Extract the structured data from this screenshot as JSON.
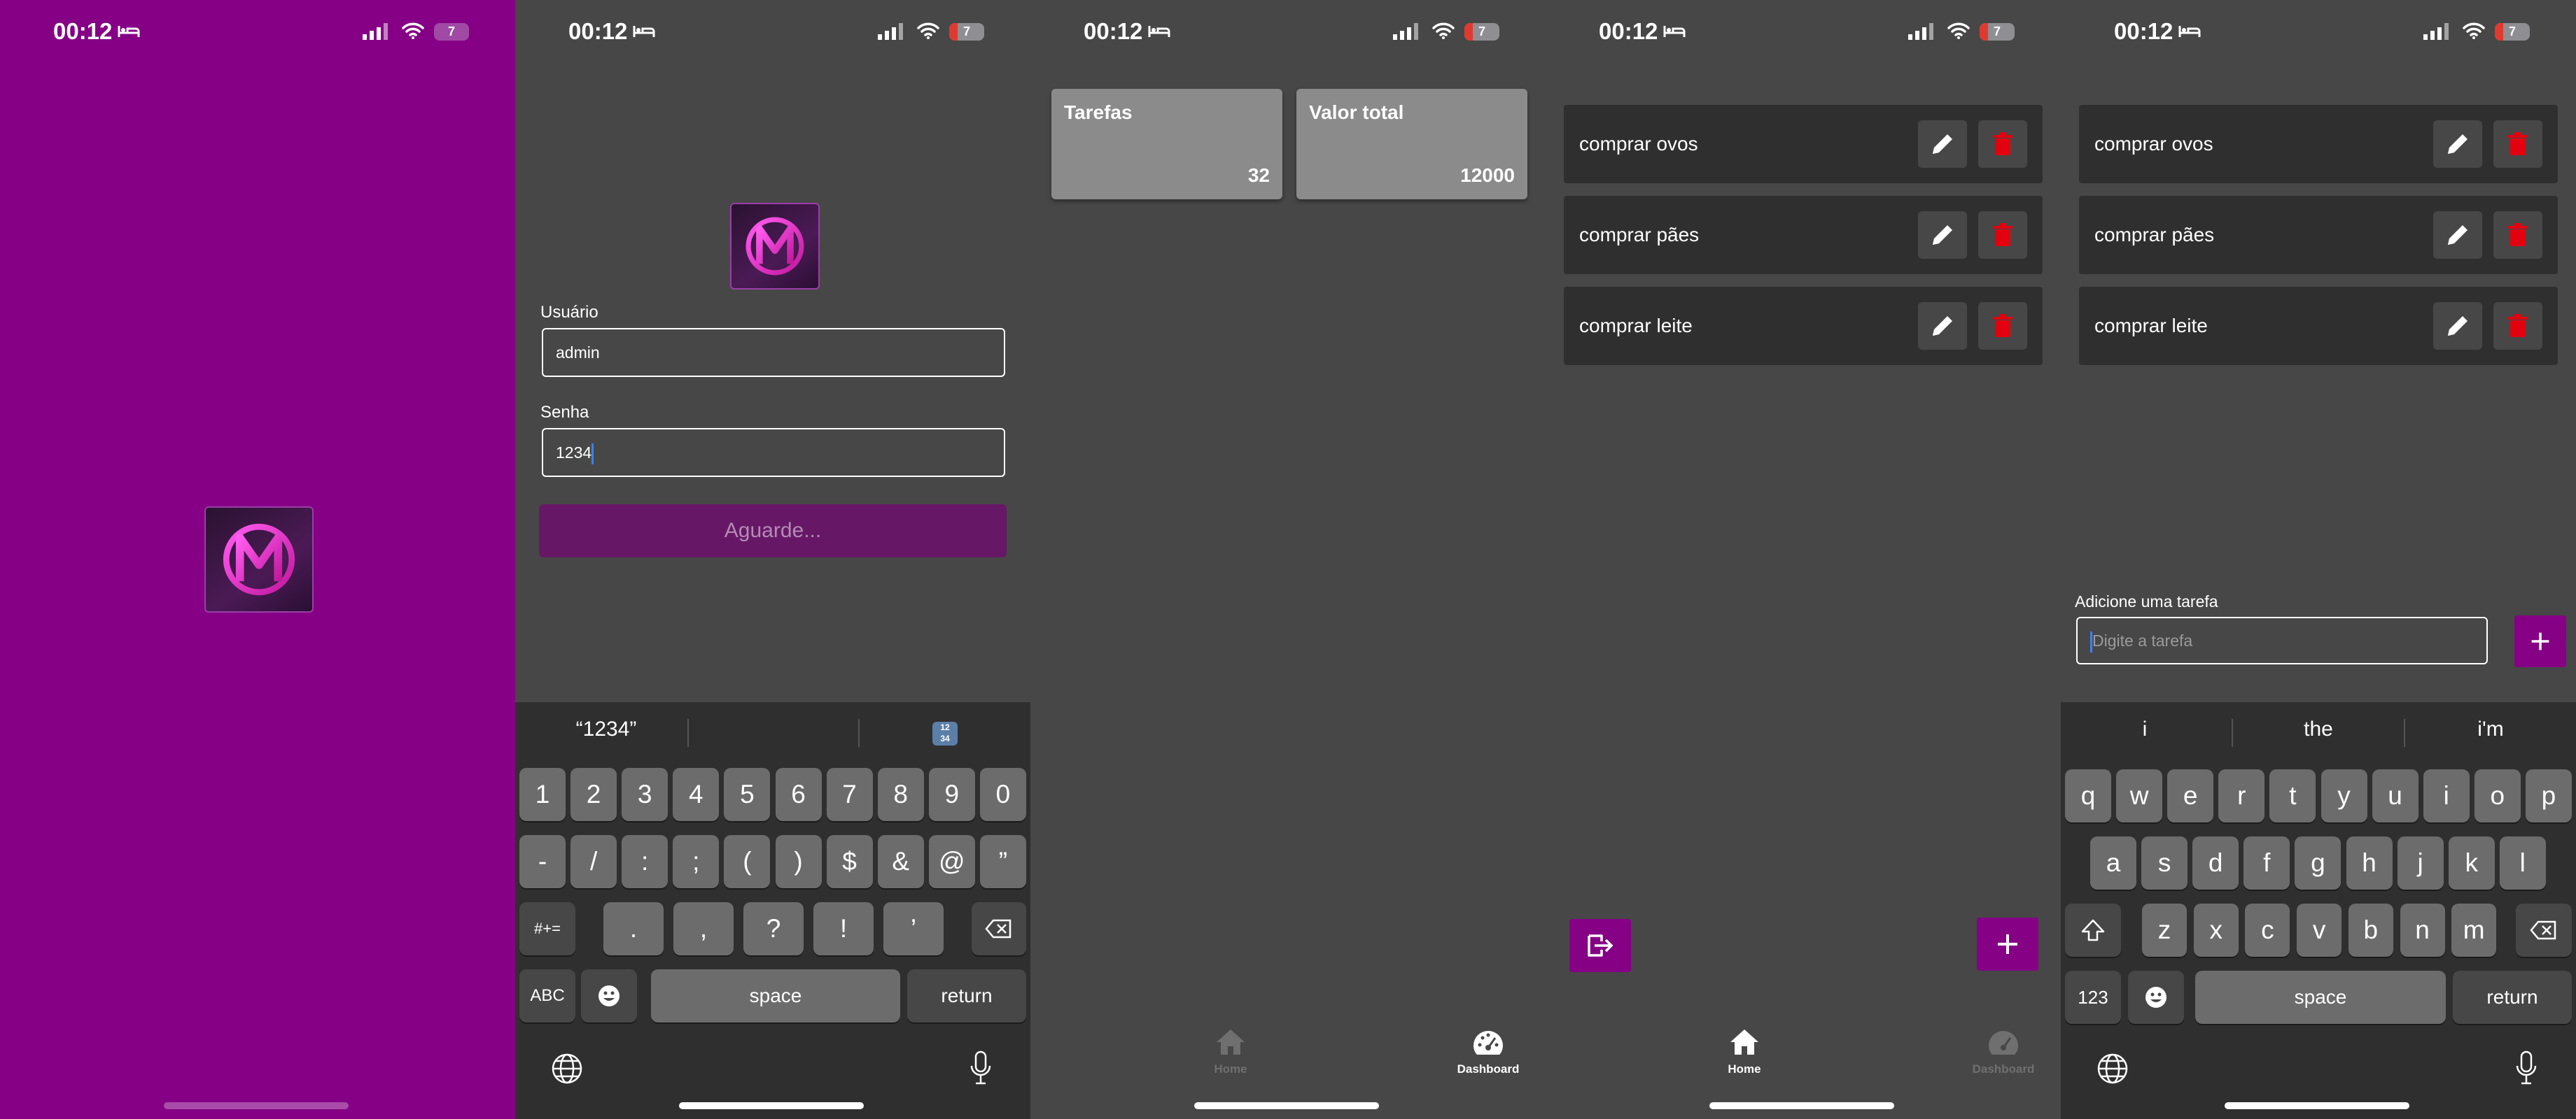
{
  "status_bar": {
    "time": "00:12",
    "battery": "7"
  },
  "splash": {
    "logo": "app-logo"
  },
  "login": {
    "user_label": "Usuário",
    "user_value": "admin",
    "password_label": "Senha",
    "password_value": "1234",
    "button_label": "Aguarde...",
    "keyboard": {
      "suggestion": "“1234”",
      "row1": [
        "1",
        "2",
        "3",
        "4",
        "5",
        "6",
        "7",
        "8",
        "9",
        "0"
      ],
      "row2": [
        "-",
        "/",
        ":",
        ";",
        "(",
        ")",
        "$",
        "&",
        "@",
        "”"
      ],
      "row3": [
        ".",
        ",",
        "?",
        "!",
        "’"
      ],
      "symbols_key": "#+=",
      "abc_key": "ABC",
      "space": "space",
      "return": "return"
    }
  },
  "dashboard": {
    "cards": [
      {
        "title": "Tarefas",
        "value": "32"
      },
      {
        "title": "Valor total",
        "value": "12000"
      }
    ]
  },
  "tabs": {
    "home": "Home",
    "dashboard": "Dashboard"
  },
  "home": {
    "tasks": [
      "comprar ovos",
      "comprar pães",
      "comprar leite"
    ]
  },
  "add_task": {
    "label": "Adicione uma tarefa",
    "placeholder": "Digite a tarefa",
    "keyboard": {
      "suggestions": [
        "i",
        "the",
        "i'm"
      ],
      "row1": [
        "q",
        "w",
        "e",
        "r",
        "t",
        "y",
        "u",
        "i",
        "o",
        "p"
      ],
      "row2": [
        "a",
        "s",
        "d",
        "f",
        "g",
        "h",
        "j",
        "k",
        "l"
      ],
      "row3": [
        "z",
        "x",
        "c",
        "v",
        "b",
        "n",
        "m"
      ],
      "num_key": "123",
      "space": "space",
      "return": "return"
    }
  },
  "colors": {
    "brand": "#850085",
    "background": "#474747",
    "delete": "#e3000f"
  }
}
